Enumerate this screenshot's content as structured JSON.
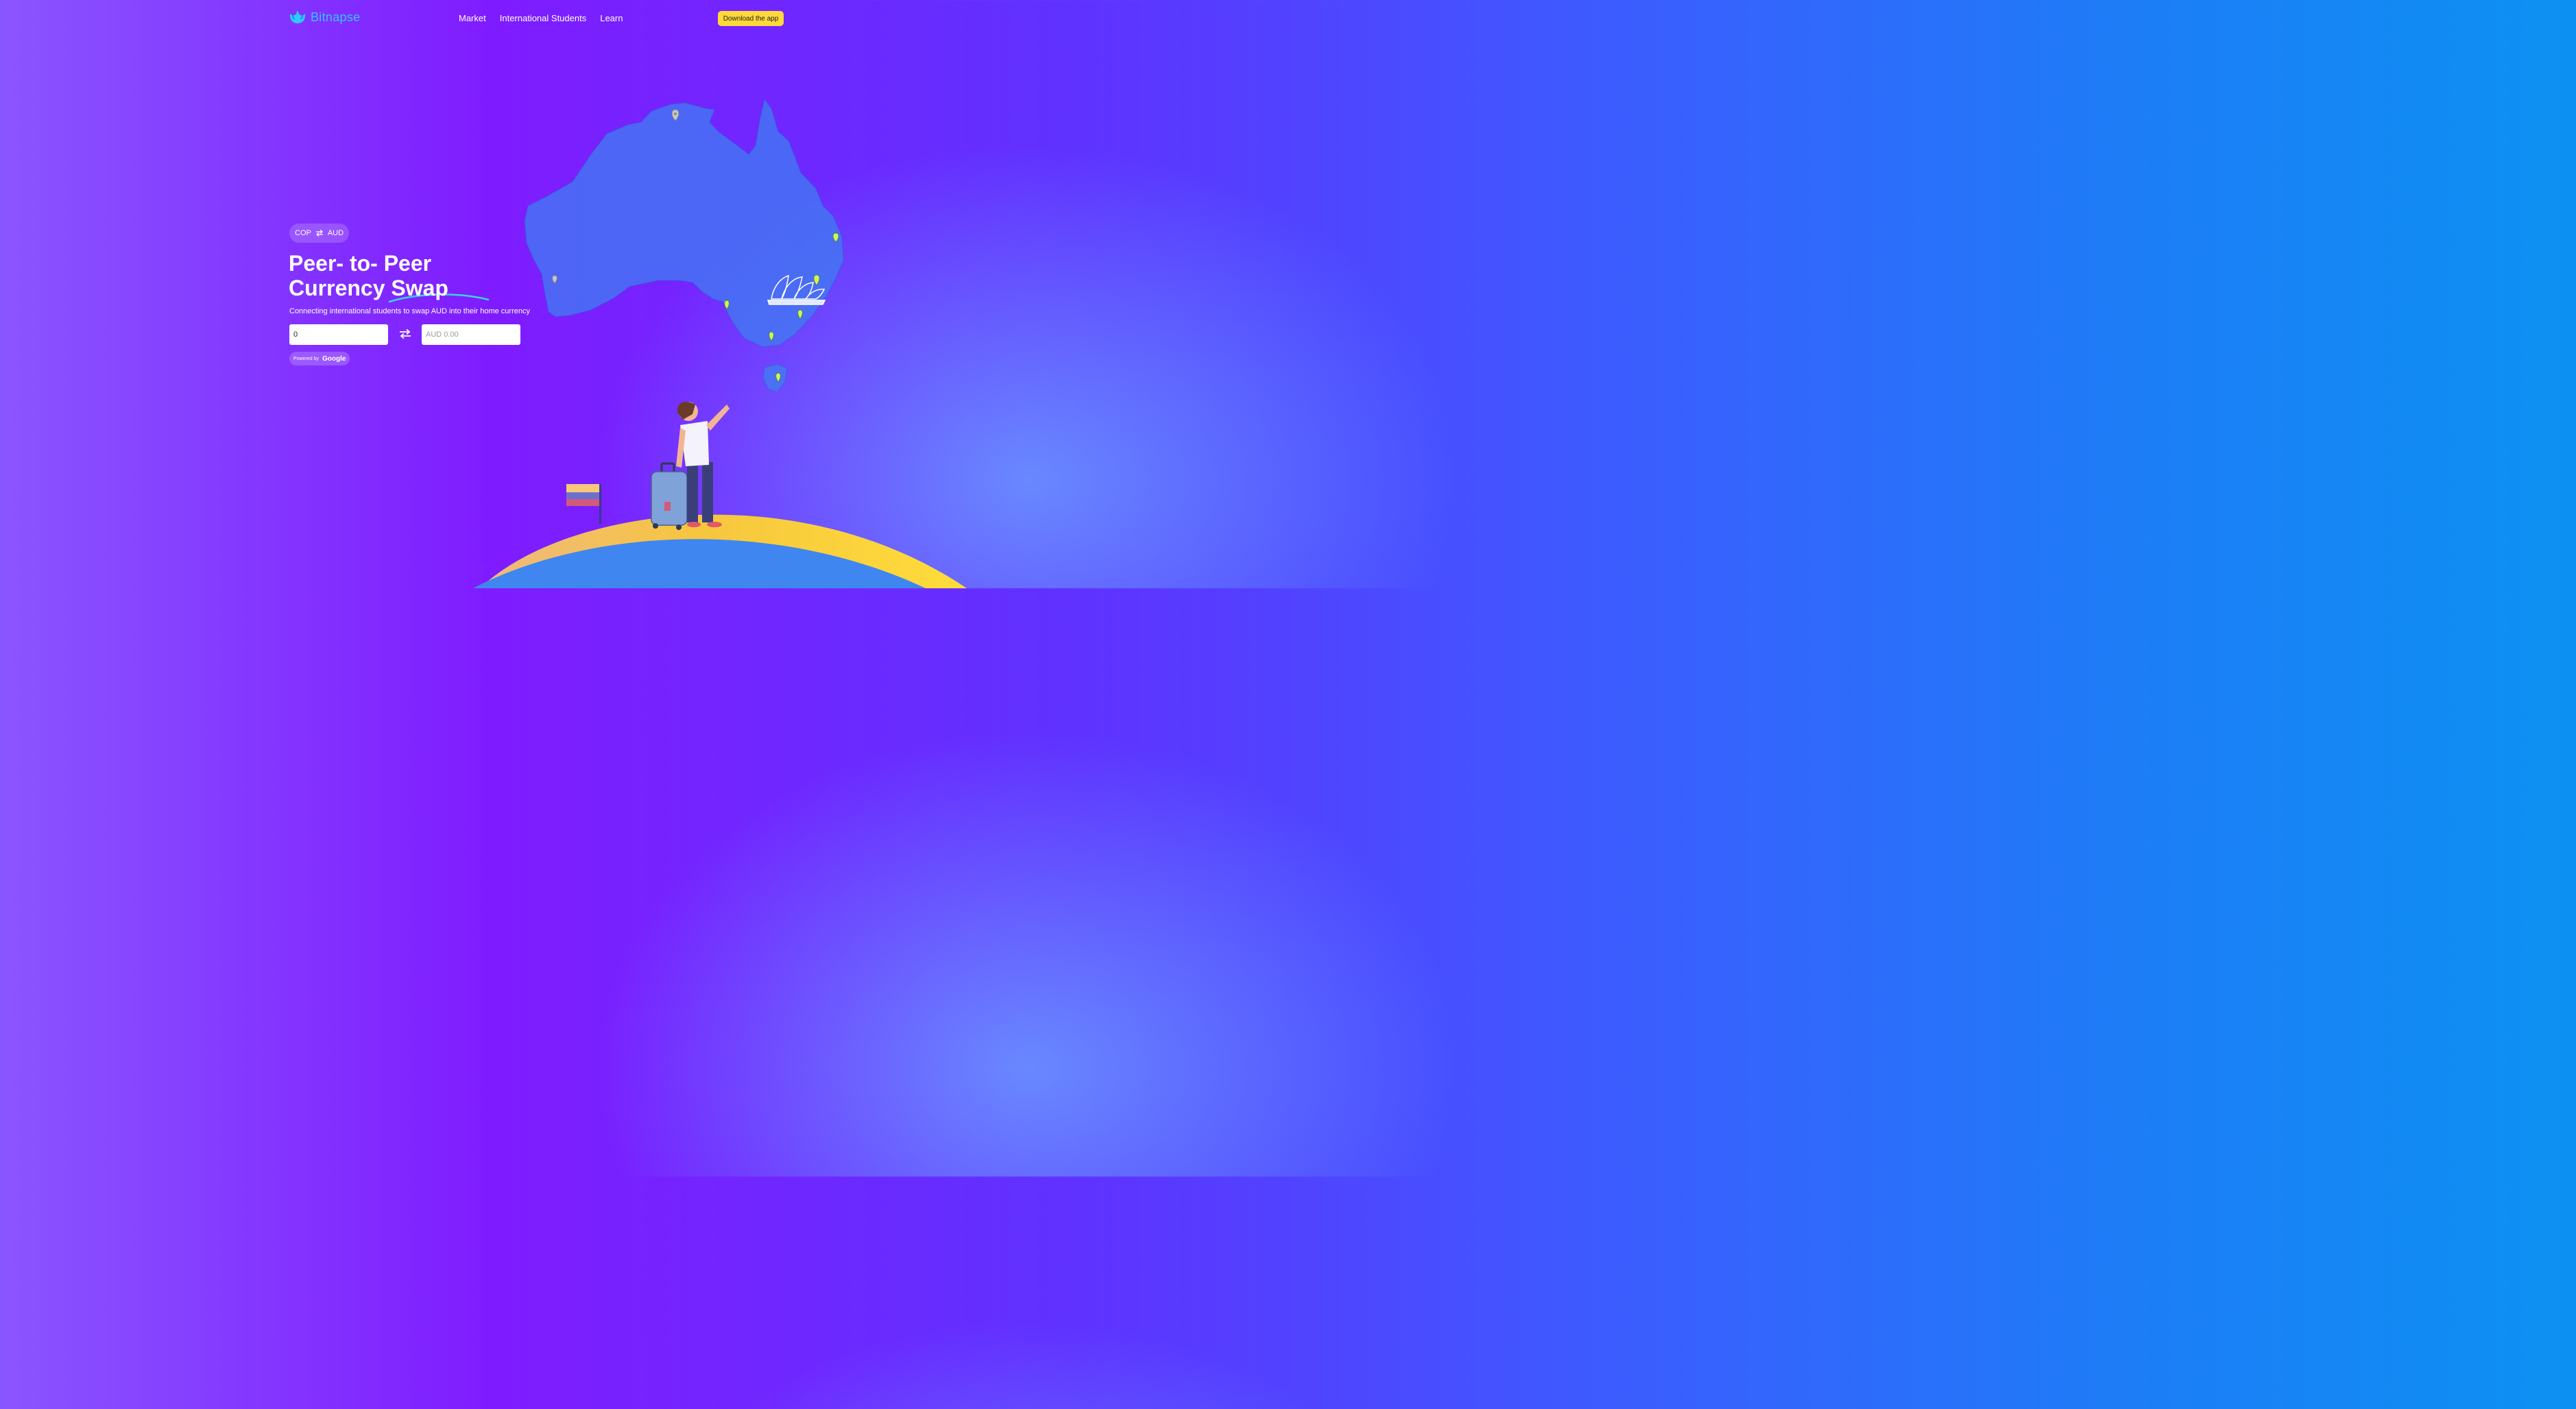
{
  "brand": {
    "name": "Bitnapse"
  },
  "nav": {
    "items": [
      "Market",
      "International Students",
      "Learn"
    ]
  },
  "header": {
    "download_label": "Download the app"
  },
  "hero": {
    "pair": {
      "from": "COP",
      "to": "AUD"
    },
    "title_line1": "Peer- to- Peer",
    "title_line2": "Currency Swap",
    "subtitle": "Connecting international students to swap AUD into their home currency",
    "from_value": "0",
    "to_placeholder": "AUD 0.00",
    "powered_by": "Powered by",
    "powered_brand": "Google"
  },
  "colors": {
    "accent_yellow": "#ffd83a",
    "logo_cyan": "#2ec9ff"
  },
  "icons": [
    "logo-icon",
    "swap-arrows-icon",
    "map-pin-icon",
    "opera-house-icon"
  ]
}
